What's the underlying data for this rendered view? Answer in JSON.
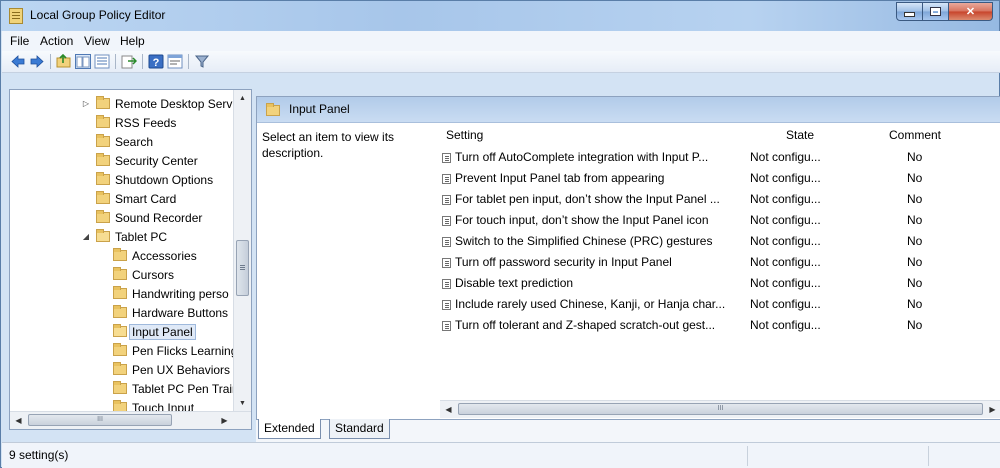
{
  "window": {
    "title": "Local Group Policy Editor"
  },
  "menu": [
    "File",
    "Action",
    "View",
    "Help"
  ],
  "toolbar": [
    "back-arrow",
    "forward-arrow",
    "up-folder",
    "show-hide-tree",
    "export-list",
    "help",
    "properties",
    "filter"
  ],
  "tree": {
    "items": [
      {
        "label": "Remote Desktop Serv",
        "indent": 0,
        "expander": "collapsed"
      },
      {
        "label": "RSS Feeds",
        "indent": 0,
        "expander": ""
      },
      {
        "label": "Search",
        "indent": 0,
        "expander": ""
      },
      {
        "label": "Security Center",
        "indent": 0,
        "expander": ""
      },
      {
        "label": "Shutdown Options",
        "indent": 0,
        "expander": ""
      },
      {
        "label": "Smart Card",
        "indent": 0,
        "expander": ""
      },
      {
        "label": "Sound Recorder",
        "indent": 0,
        "expander": ""
      },
      {
        "label": "Tablet PC",
        "indent": 0,
        "expander": "expanded"
      },
      {
        "label": "Accessories",
        "indent": 1,
        "expander": ""
      },
      {
        "label": "Cursors",
        "indent": 1,
        "expander": ""
      },
      {
        "label": "Handwriting perso",
        "indent": 1,
        "expander": ""
      },
      {
        "label": "Hardware Buttons",
        "indent": 1,
        "expander": ""
      },
      {
        "label": "Input Panel",
        "indent": 1,
        "expander": "",
        "selected": true
      },
      {
        "label": "Pen Flicks Learning",
        "indent": 1,
        "expander": ""
      },
      {
        "label": "Pen UX Behaviors",
        "indent": 1,
        "expander": ""
      },
      {
        "label": "Tablet PC Pen Trair",
        "indent": 1,
        "expander": ""
      },
      {
        "label": "Touch Input",
        "indent": 1,
        "expander": ""
      }
    ]
  },
  "panel": {
    "title": "Input Panel",
    "description": "Select an item to view its description.",
    "columns": {
      "setting": "Setting",
      "state": "State",
      "comment": "Comment"
    },
    "rows": [
      {
        "setting": "Turn off AutoComplete integration with Input P...",
        "state": "Not configu...",
        "comment": "No"
      },
      {
        "setting": "Prevent Input Panel tab from appearing",
        "state": "Not configu...",
        "comment": "No"
      },
      {
        "setting": "For tablet pen input, don’t show the Input Panel ...",
        "state": "Not configu...",
        "comment": "No"
      },
      {
        "setting": "For touch input, don’t show the Input Panel icon",
        "state": "Not configu...",
        "comment": "No"
      },
      {
        "setting": "Switch to the Simplified Chinese (PRC) gestures",
        "state": "Not configu...",
        "comment": "No"
      },
      {
        "setting": "Turn off password security in Input Panel",
        "state": "Not configu...",
        "comment": "No"
      },
      {
        "setting": "Disable text prediction",
        "state": "Not configu...",
        "comment": "No"
      },
      {
        "setting": "Include rarely used Chinese, Kanji, or Hanja char...",
        "state": "Not configu...",
        "comment": "No"
      },
      {
        "setting": "Turn off tolerant and Z-shaped scratch-out gest...",
        "state": "Not configu...",
        "comment": "No"
      }
    ]
  },
  "tabs": [
    "Extended",
    "Standard"
  ],
  "status": {
    "text": "9 setting(s)"
  }
}
